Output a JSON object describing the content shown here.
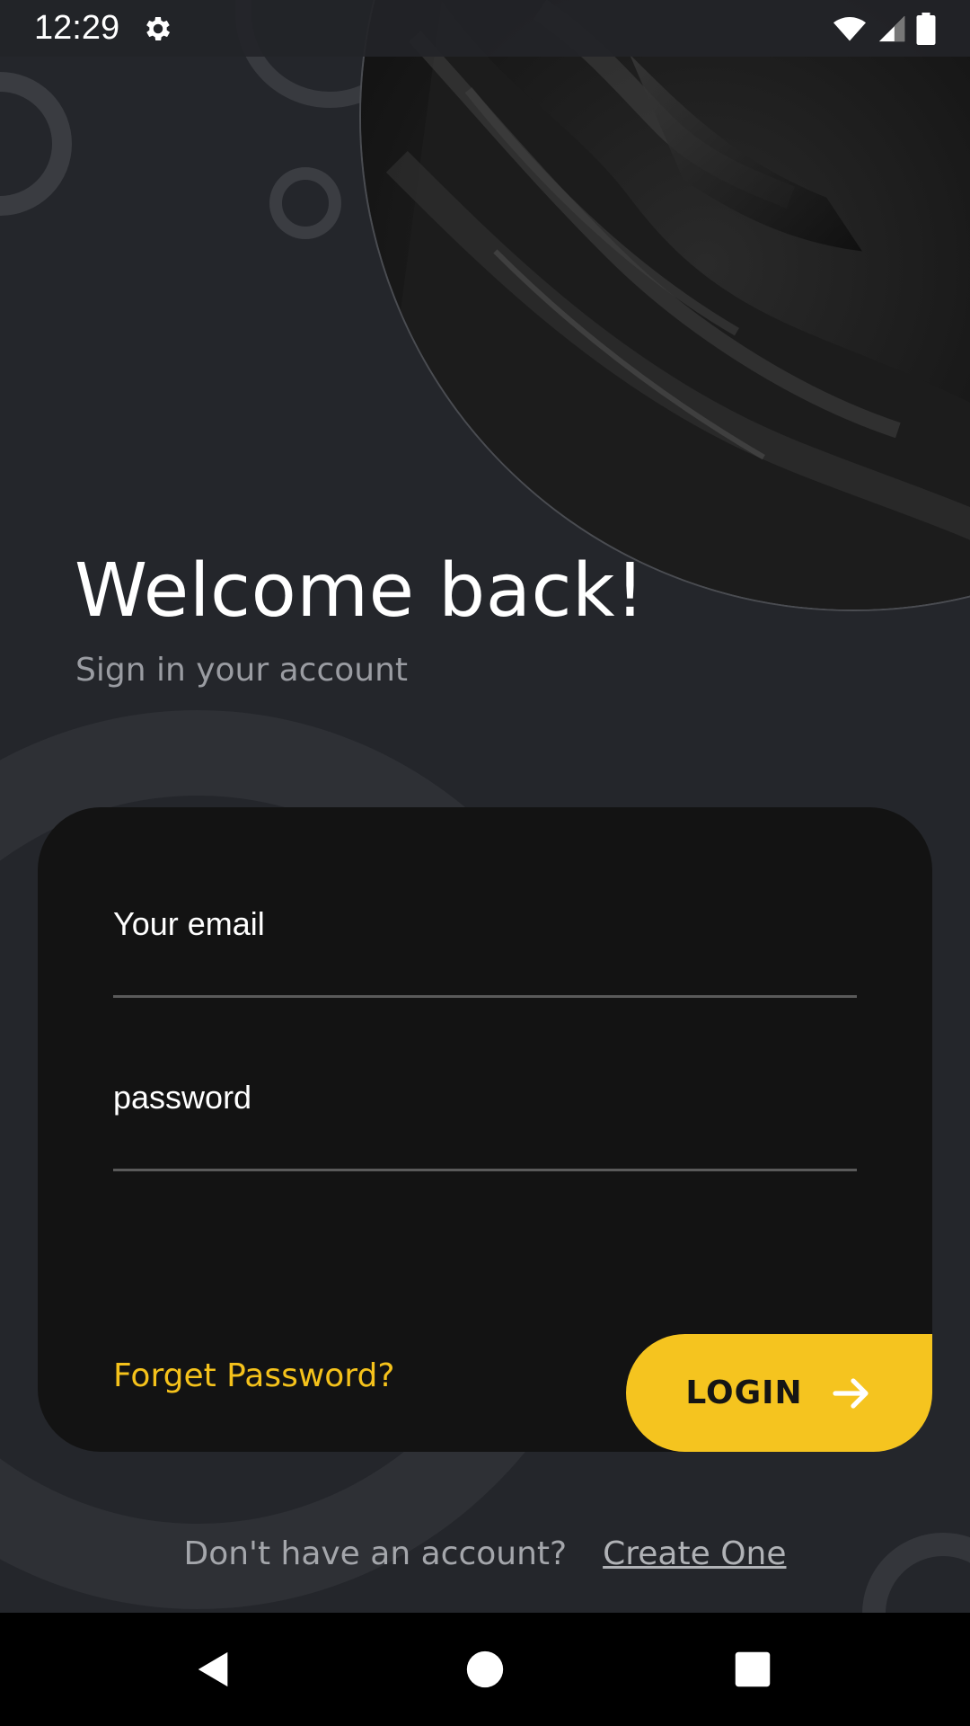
{
  "status_bar": {
    "time": "12:29",
    "icons": [
      "gear-icon",
      "wifi-icon",
      "signal-icon",
      "battery-icon"
    ]
  },
  "header": {
    "title": "Welcome back!",
    "subtitle": "Sign in your account"
  },
  "form": {
    "email_placeholder": "Your email",
    "email_value": "",
    "password_placeholder": "password",
    "password_value": "",
    "forgot_label": "Forget Password?",
    "login_label": "LOGIN"
  },
  "footer": {
    "no_account_text": "Don't have an account?",
    "create_label": "Create One"
  },
  "nav": {
    "icons": [
      "back-icon",
      "home-icon",
      "recents-icon"
    ]
  },
  "colors": {
    "background": "#24262b",
    "card": "#131313",
    "accent": "#f5c41f",
    "text_primary": "#ffffff",
    "text_muted": "#9a9ca2"
  }
}
